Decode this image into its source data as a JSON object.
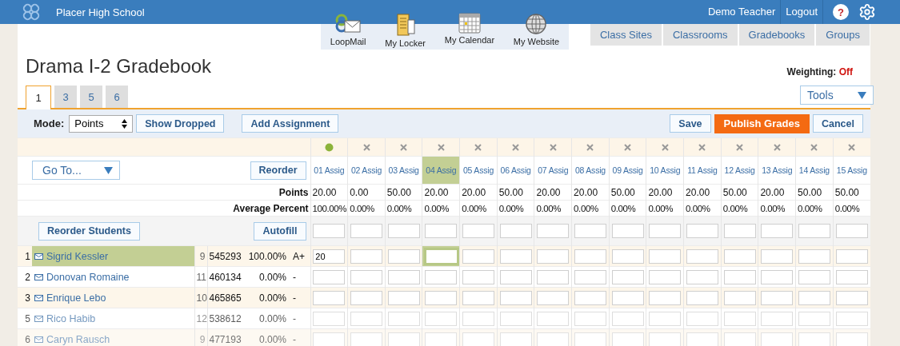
{
  "header": {
    "school": "Placer High School",
    "user": "Demo Teacher",
    "logout": "Logout",
    "help": "?"
  },
  "apps": [
    {
      "kind": "mail",
      "label": "LoopMail"
    },
    {
      "kind": "locker",
      "label": "My Locker"
    },
    {
      "kind": "calendar",
      "label": "My Calendar"
    },
    {
      "kind": "website",
      "label": "My Website"
    }
  ],
  "nav": [
    "Class Sites",
    "Classrooms",
    "Gradebooks",
    "Groups"
  ],
  "title": "Drama I-2 Gradebook",
  "weighting": {
    "label": "Weighting:",
    "value": "Off"
  },
  "tabs": [
    {
      "label": "1",
      "selected": true
    },
    {
      "label": "3",
      "selected": false
    },
    {
      "label": "5",
      "selected": false
    },
    {
      "label": "6",
      "selected": false
    }
  ],
  "tools": "Tools",
  "toolbar": {
    "mode_label": "Mode:",
    "mode": "Points",
    "show_dropped": "Show Dropped",
    "add_assignment": "Add Assignment",
    "save": "Save",
    "publish": "Publish Grades",
    "cancel": "Cancel"
  },
  "grid": {
    "goto": "Go To...",
    "reorder": "Reorder",
    "points_label": "Points",
    "average_label": "Average Percent",
    "reorder_students": "Reorder Students",
    "autofill": "Autofill"
  },
  "assignments": [
    {
      "published": true,
      "label": "01 Assig",
      "points": "20.00",
      "average": "100.00%",
      "selected": false
    },
    {
      "published": false,
      "label": "02 Assig",
      "points": "0.00",
      "average": "0.00%",
      "selected": false
    },
    {
      "published": false,
      "label": "03 Assig",
      "points": "50.00",
      "average": "0.00%",
      "selected": false
    },
    {
      "published": false,
      "label": "04 Assig",
      "points": "20.00",
      "average": "0.00%",
      "selected": true
    },
    {
      "published": false,
      "label": "05 Assig",
      "points": "20.00",
      "average": "0.00%",
      "selected": false
    },
    {
      "published": false,
      "label": "06 Assig",
      "points": "50.00",
      "average": "0.00%",
      "selected": false
    },
    {
      "published": false,
      "label": "07 Assig",
      "points": "20.00",
      "average": "0.00%",
      "selected": false
    },
    {
      "published": false,
      "label": "08 Assig",
      "points": "20.00",
      "average": "0.00%",
      "selected": false
    },
    {
      "published": false,
      "label": "09 Assig",
      "points": "50.00",
      "average": "0.00%",
      "selected": false
    },
    {
      "published": false,
      "label": "10 Assig",
      "points": "20.00",
      "average": "0.00%",
      "selected": false
    },
    {
      "published": false,
      "label": "11 Assig",
      "points": "20.00",
      "average": "0.00%",
      "selected": false
    },
    {
      "published": false,
      "label": "12 Assig",
      "points": "50.00",
      "average": "0.00%",
      "selected": false
    },
    {
      "published": false,
      "label": "13 Assig",
      "points": "20.00",
      "average": "0.00%",
      "selected": false
    },
    {
      "published": false,
      "label": "14 Assig",
      "points": "50.00",
      "average": "0.00%",
      "selected": false
    },
    {
      "published": false,
      "label": "15 Assig",
      "points": "50.00",
      "average": "0.00%",
      "selected": false
    }
  ],
  "students": [
    {
      "number": "1",
      "name": "Sigrid Kessler",
      "grade": "9",
      "id": "545293",
      "percent": "100.00%",
      "letter": "A+",
      "selected": true,
      "scores": [
        "20"
      ]
    },
    {
      "number": "2",
      "name": "Donovan Romaine",
      "grade": "11",
      "id": "460134",
      "percent": "0.00%",
      "letter": "-",
      "selected": false
    },
    {
      "number": "3",
      "name": "Enrique Lebo",
      "grade": "10",
      "id": "465865",
      "percent": "0.00%",
      "letter": "-",
      "selected": false
    },
    {
      "number": "5",
      "name": "Rico Habib",
      "grade": "12",
      "id": "538612",
      "percent": "0.00%",
      "letter": "-",
      "selected": false
    },
    {
      "number": "6",
      "name": "Caryn Rausch",
      "grade": "9",
      "id": "477193",
      "percent": "0.00%",
      "letter": "-",
      "selected": false
    }
  ]
}
